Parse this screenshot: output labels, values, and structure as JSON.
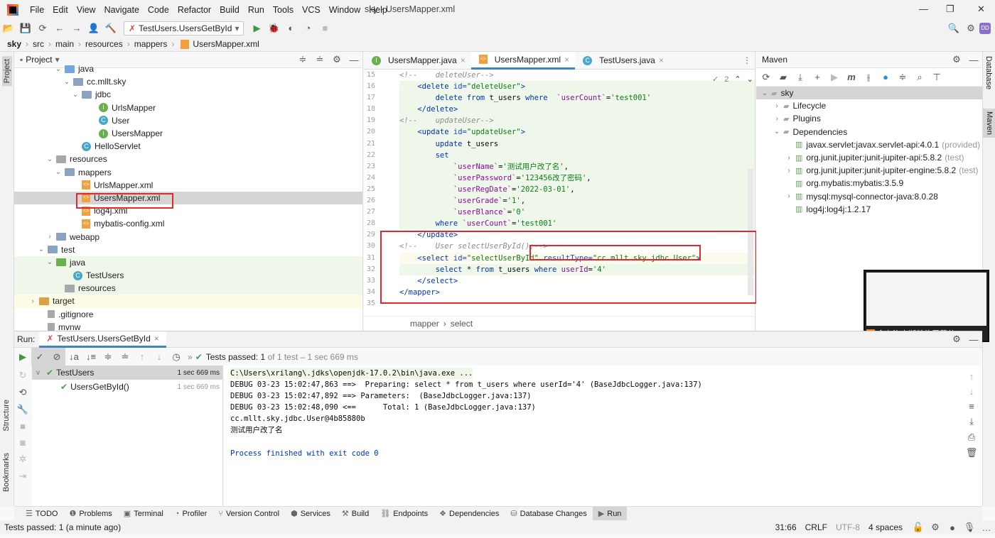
{
  "window": {
    "title": "sky - UsersMapper.xml",
    "menu": [
      "File",
      "Edit",
      "View",
      "Navigate",
      "Code",
      "Refactor",
      "Build",
      "Run",
      "Tools",
      "VCS",
      "Window",
      "Help"
    ],
    "avatar": "DD"
  },
  "toolbar": {
    "run_config": "TestUsers.UsersGetById"
  },
  "breadcrumb": [
    "sky",
    "src",
    "main",
    "resources",
    "mappers",
    "UsersMapper.xml"
  ],
  "left_strip": {
    "project": "Project",
    "structure": "Structure",
    "bookmarks": "Bookmarks"
  },
  "right_strip": {
    "database": "Database",
    "maven": "Maven"
  },
  "project": {
    "title": "Project",
    "items": [
      {
        "label": "java",
        "indent": 4,
        "icon": "folder-src",
        "chev": "v"
      },
      {
        "label": "cc.mllt.sky",
        "indent": 5,
        "icon": "folder",
        "chev": "v"
      },
      {
        "label": "jdbc",
        "indent": 6,
        "icon": "folder",
        "chev": "v"
      },
      {
        "label": "UrlsMapper",
        "indent": 8,
        "icon": "interface"
      },
      {
        "label": "User",
        "indent": 8,
        "icon": "class"
      },
      {
        "label": "UsersMapper",
        "indent": 8,
        "icon": "interface"
      },
      {
        "label": "HelloServlet",
        "indent": 6,
        "icon": "class"
      },
      {
        "label": "resources",
        "indent": 3,
        "icon": "folder-res",
        "chev": "v"
      },
      {
        "label": "mappers",
        "indent": 4,
        "icon": "folder",
        "chev": "v"
      },
      {
        "label": "UrlsMapper.xml",
        "indent": 6,
        "icon": "xml"
      },
      {
        "label": "UsersMapper.xml",
        "indent": 6,
        "icon": "xml",
        "selected": true
      },
      {
        "label": "log4j.xml",
        "indent": 6,
        "icon": "xml"
      },
      {
        "label": "mybatis-config.xml",
        "indent": 6,
        "icon": "xml"
      },
      {
        "label": "webapp",
        "indent": 3,
        "icon": "folder",
        "chev": ">"
      },
      {
        "label": "test",
        "indent": 2,
        "icon": "folder",
        "chev": "v"
      },
      {
        "label": "java",
        "indent": 3,
        "icon": "folder-test",
        "chev": "v",
        "green": true
      },
      {
        "label": "TestUsers",
        "indent": 5,
        "icon": "class",
        "green": true
      },
      {
        "label": "resources",
        "indent": 4,
        "icon": "folder-res",
        "green": true
      },
      {
        "label": "target",
        "indent": 1,
        "icon": "folder-target",
        "chev": ">",
        "yellow": true
      },
      {
        "label": ".gitignore",
        "indent": 2,
        "icon": "file"
      },
      {
        "label": "mvnw",
        "indent": 2,
        "icon": "file"
      }
    ]
  },
  "editor": {
    "tabs": [
      {
        "label": "UsersMapper.java",
        "icon": "interface"
      },
      {
        "label": "UsersMapper.xml",
        "icon": "xml",
        "active": true
      },
      {
        "label": "TestUsers.java",
        "icon": "class"
      }
    ],
    "inspections": "2",
    "first_line": 15,
    "lines": [
      [
        [
          "cm",
          "<!--    deleteUser-->"
        ]
      ],
      [
        [
          "tx",
          "    "
        ],
        [
          "tg",
          "<delete "
        ],
        [
          "at",
          "id="
        ],
        [
          "st",
          "\"deleteUser\""
        ],
        [
          "tg",
          ">"
        ]
      ],
      [
        [
          "tx",
          "        "
        ],
        [
          "kw",
          "delete from "
        ],
        [
          "tx",
          "t_users "
        ],
        [
          "kw",
          "where  "
        ],
        [
          "fd",
          "`userCount`"
        ],
        [
          "tx",
          "="
        ],
        [
          "st",
          "'test001'"
        ]
      ],
      [
        [
          "tx",
          "    "
        ],
        [
          "tg",
          "</delete>"
        ]
      ],
      [
        [
          "cm",
          "<!--    updateUser-->"
        ]
      ],
      [
        [
          "tx",
          "    "
        ],
        [
          "tg",
          "<update "
        ],
        [
          "at",
          "id="
        ],
        [
          "st",
          "\"updateUser\""
        ],
        [
          "tg",
          ">"
        ]
      ],
      [
        [
          "tx",
          "        "
        ],
        [
          "kw",
          "update "
        ],
        [
          "tx",
          "t_users"
        ]
      ],
      [
        [
          "tx",
          "        "
        ],
        [
          "kw",
          "set"
        ]
      ],
      [
        [
          "tx",
          "            "
        ],
        [
          "fd",
          "`userName`"
        ],
        [
          "tx",
          "="
        ],
        [
          "st",
          "'测试用户改了名'"
        ],
        [
          "tx",
          ","
        ]
      ],
      [
        [
          "tx",
          "            "
        ],
        [
          "fd",
          "`userPassword`"
        ],
        [
          "tx",
          "="
        ],
        [
          "st",
          "'123456改了密码'"
        ],
        [
          "tx",
          ","
        ]
      ],
      [
        [
          "tx",
          "            "
        ],
        [
          "fd",
          "`userRegDate`"
        ],
        [
          "tx",
          "="
        ],
        [
          "st",
          "'2022-03-01'"
        ],
        [
          "tx",
          ","
        ]
      ],
      [
        [
          "tx",
          "            "
        ],
        [
          "fd",
          "`userGrade`"
        ],
        [
          "tx",
          "="
        ],
        [
          "st",
          "'1'"
        ],
        [
          "tx",
          ","
        ]
      ],
      [
        [
          "tx",
          "            "
        ],
        [
          "fd",
          "`userBlance`"
        ],
        [
          "tx",
          "="
        ],
        [
          "st",
          "'0'"
        ]
      ],
      [
        [
          "tx",
          "        "
        ],
        [
          "kw",
          "where "
        ],
        [
          "fd",
          "`userCount`"
        ],
        [
          "tx",
          "="
        ],
        [
          "st",
          "'test001'"
        ]
      ],
      [
        [
          "tx",
          "    "
        ],
        [
          "tg",
          "</update>"
        ]
      ],
      [
        [
          "cm",
          "<!--    User selectUserById();-->"
        ]
      ],
      [
        [
          "tx",
          "    "
        ],
        [
          "tg",
          "<select "
        ],
        [
          "at",
          "id="
        ],
        [
          "st",
          "\"selectUserById\" "
        ],
        [
          "at",
          "resultType="
        ],
        [
          "st",
          "\"cc.mllt.sky.jdbc.User\""
        ],
        [
          "tg",
          ">"
        ]
      ],
      [
        [
          "tx",
          "        "
        ],
        [
          "kw",
          "select "
        ],
        [
          "tx",
          "* "
        ],
        [
          "kw",
          "from "
        ],
        [
          "tx",
          "t_users "
        ],
        [
          "kw",
          "where "
        ],
        [
          "fd",
          "userId"
        ],
        [
          "tx",
          "="
        ],
        [
          "st",
          "'4'"
        ]
      ],
      [
        [
          "tx",
          "    "
        ],
        [
          "tg",
          "</select>"
        ]
      ],
      [
        [
          "tg",
          "</mapper>"
        ]
      ],
      [
        [
          "tx",
          ""
        ]
      ]
    ],
    "crumbs": [
      "mapper",
      "select"
    ]
  },
  "maven": {
    "title": "Maven",
    "items": [
      {
        "label": "sky",
        "indent": 0,
        "chev": "v",
        "selected": true
      },
      {
        "label": "Lifecycle",
        "indent": 1,
        "chev": ">"
      },
      {
        "label": "Plugins",
        "indent": 1,
        "chev": ">"
      },
      {
        "label": "Dependencies",
        "indent": 1,
        "chev": "v"
      },
      {
        "label": "javax.servlet:javax.servlet-api:4.0.1",
        "scope": "(provided)",
        "indent": 2
      },
      {
        "label": "org.junit.jupiter:junit-jupiter-api:5.8.2",
        "scope": "(test)",
        "indent": 2,
        "chev": ">"
      },
      {
        "label": "org.junit.jupiter:junit-jupiter-engine:5.8.2",
        "scope": "(test)",
        "indent": 2,
        "chev": ">"
      },
      {
        "label": "org.mybatis:mybatis:3.5.9",
        "indent": 2
      },
      {
        "label": "mysql:mysql-connector-java:8.0.28",
        "indent": 2,
        "chev": ">"
      },
      {
        "label": "log4j:log4j:1.2.17",
        "indent": 2
      }
    ]
  },
  "run": {
    "label": "Run:",
    "tab": "TestUsers.UsersGetById",
    "summary_prefix": "Tests passed:",
    "summary_count": "1",
    "summary_rest": "of 1 test – 1 sec 669 ms",
    "tests": [
      {
        "name": "TestUsers",
        "time": "1 sec 669 ms"
      },
      {
        "name": "UsersGetById()",
        "time": "1 sec 669 ms"
      }
    ],
    "console": [
      "C:\\Users\\xrilang\\.jdks\\openjdk-17.0.2\\bin\\java.exe ...",
      "DEBUG 03-23 15:02:47,863 ==>  Preparing: select * from t_users where userId='4' (BaseJdbcLogger.java:137)",
      "DEBUG 03-23 15:02:47,892 ==> Parameters:  (BaseJdbcLogger.java:137)",
      "DEBUG 03-23 15:02:48,090 <==      Total: 1 (BaseJdbcLogger.java:137)",
      "cc.mllt.sky.jdbc.User@4b85880b",
      "测试用户改了名",
      "",
      "Process finished with exit code 0"
    ]
  },
  "bottom_tabs": [
    "TODO",
    "Problems",
    "Terminal",
    "Profiler",
    "Version Control",
    "Services",
    "Build",
    "Endpoints",
    "Dependencies",
    "Database Changes",
    "Run"
  ],
  "status": {
    "message": "Tests passed: 1 (a minute ago)",
    "position": "31:66",
    "line_sep": "CRLF",
    "encoding": "UTF-8",
    "indent": "4 spaces"
  },
  "screen_share": {
    "label": "余布洛夫斯基的屏幕共..."
  },
  "colors": {
    "highlight": "#e0282e",
    "accent": "#4083c9",
    "added_bg": "#eef7e9"
  }
}
